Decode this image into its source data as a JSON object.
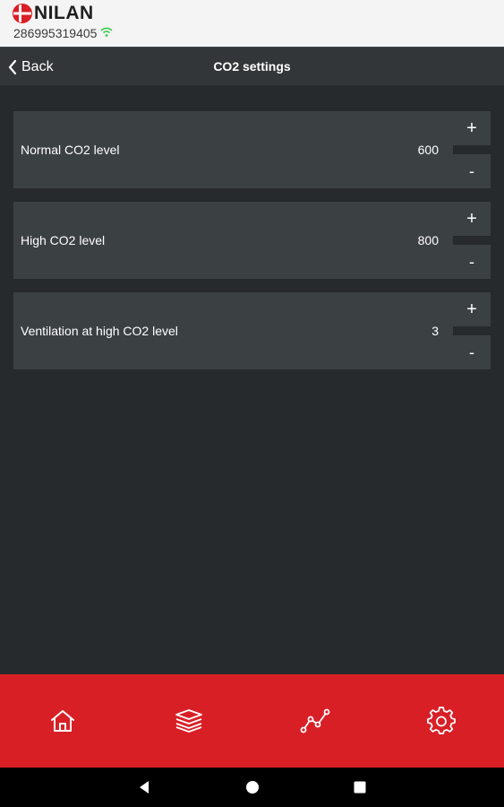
{
  "brand": {
    "logo_text": "NILAN",
    "serial": "286995319405"
  },
  "header": {
    "back_label": "Back",
    "title": "CO2 settings"
  },
  "settings": [
    {
      "label": "Normal CO2 level",
      "value": "600",
      "plus": "+",
      "minus": "-"
    },
    {
      "label": "High CO2 level",
      "value": "800",
      "plus": "+",
      "minus": "-"
    },
    {
      "label": "Ventilation at high CO2 level",
      "value": "3",
      "plus": "+",
      "minus": "-"
    }
  ],
  "tabbar": {
    "icons": [
      "home-icon",
      "layers-icon",
      "graph-icon",
      "gear-icon"
    ]
  },
  "colors": {
    "accent": "#d91f26",
    "background": "#272a2d",
    "card": "#3b4043",
    "wifi": "#2ecc40"
  }
}
